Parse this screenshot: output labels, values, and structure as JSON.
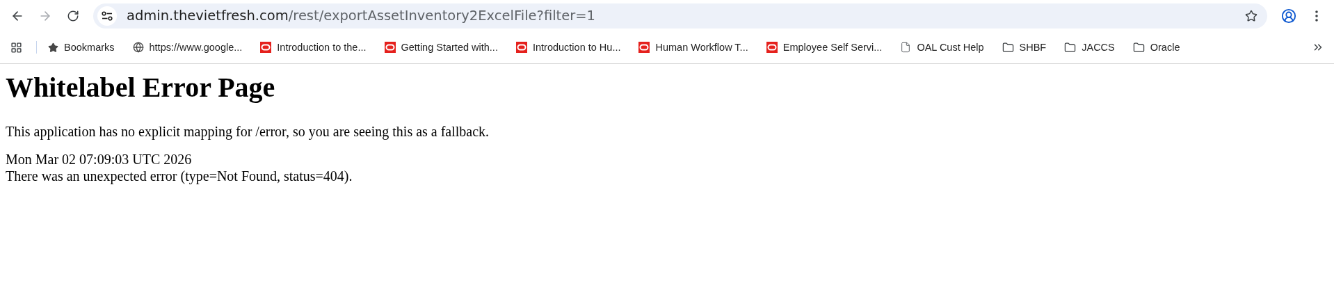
{
  "toolbar": {
    "back": {
      "disabled": false
    },
    "forward": {
      "disabled": true
    },
    "address": {
      "host": "admin.thevietfresh.com",
      "path": "/rest/exportAssetInventory2ExcelFile?filter=1"
    }
  },
  "bookmarks": [
    {
      "kind": "star",
      "label": "Bookmarks"
    },
    {
      "kind": "globe",
      "label": "https://www.google..."
    },
    {
      "kind": "oracle",
      "label": "Introduction to the..."
    },
    {
      "kind": "oracle",
      "label": "Getting Started with..."
    },
    {
      "kind": "oracle",
      "label": "Introduction to Hu..."
    },
    {
      "kind": "oracle",
      "label": "Human Workflow T..."
    },
    {
      "kind": "oracle",
      "label": "Employee Self Servi..."
    },
    {
      "kind": "page",
      "label": "OAL Cust Help"
    },
    {
      "kind": "folder",
      "label": "SHBF"
    },
    {
      "kind": "folder",
      "label": "JACCS"
    },
    {
      "kind": "folder",
      "label": "Oracle"
    }
  ],
  "page": {
    "heading": "Whitelabel Error Page",
    "message": "This application has no explicit mapping for /error, so you are seeing this as a fallback.",
    "timestamp": "Mon Mar 02 07:09:03 UTC 2026",
    "error": "There was an unexpected error (type=Not Found, status=404)."
  }
}
